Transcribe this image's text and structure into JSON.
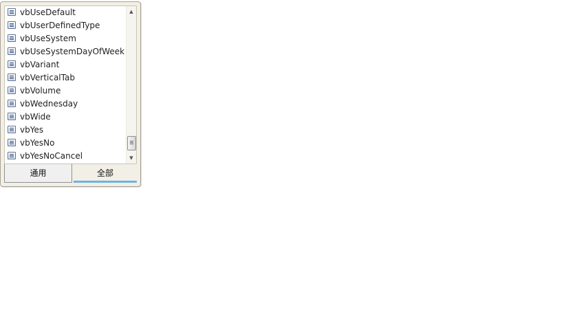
{
  "list": {
    "items": [
      {
        "label": "vbUseDefault"
      },
      {
        "label": "vbUserDefinedType"
      },
      {
        "label": "vbUseSystem"
      },
      {
        "label": "vbUseSystemDayOfWeek"
      },
      {
        "label": "vbVariant"
      },
      {
        "label": "vbVerticalTab"
      },
      {
        "label": "vbVolume"
      },
      {
        "label": "vbWednesday"
      },
      {
        "label": "vbWide"
      },
      {
        "label": "vbYes"
      },
      {
        "label": "vbYesNo"
      },
      {
        "label": "vbYesNoCancel"
      }
    ],
    "item_icon": "constant-icon",
    "scroll_up_glyph": "▲",
    "scroll_down_glyph": "▼"
  },
  "tabs": [
    {
      "label": "通用",
      "selected": false
    },
    {
      "label": "全部",
      "selected": true
    }
  ],
  "colors": {
    "selected_tab_indicator": "#6eb3e0",
    "popup_background": "#f1efe6"
  }
}
